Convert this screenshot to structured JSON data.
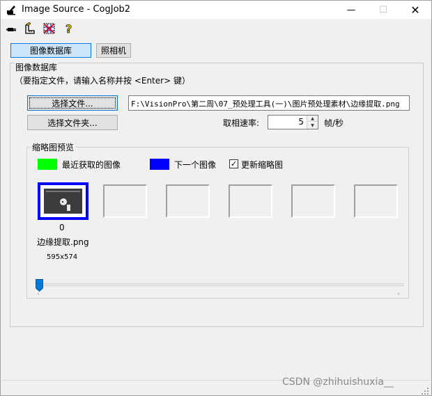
{
  "window": {
    "title": "Image Source - CogJob2",
    "controls": {
      "minimize": "—",
      "maximize": "☐",
      "close": "✕"
    }
  },
  "toolbar": {
    "icons": [
      "plug-icon",
      "ruler-icon",
      "grid-select-icon",
      "help-icon"
    ],
    "help_glyph": "?"
  },
  "tabs": [
    {
      "label": "图像数据库",
      "active": true
    },
    {
      "label": "照相机",
      "active": false
    }
  ],
  "panel": {
    "title": "图像数据库",
    "hint": "（要指定文件，请输入名称并按 <Enter> 键）",
    "select_file_label": "选择文件...",
    "select_folder_label": "选择文件夹...",
    "file_path": "F:\\VisionPro\\第二周\\07_预处理工具(一)\\图片预处理素材\\边缘提取.png",
    "rate_label": "取相速率:",
    "rate_value": "5",
    "rate_unit": "帧/秒"
  },
  "thumbnails": {
    "group_title": "缩略图预览",
    "legend_recent": "最近获取的图像",
    "legend_next": "下一个图像",
    "recent_color": "#00ff00",
    "next_color": "#0000ff",
    "refresh_label": "更新缩略图",
    "refresh_checked": "✓",
    "items": [
      {
        "index": "0",
        "name": "边缘提取.png",
        "size": "595x574"
      }
    ],
    "empty_slots": 5,
    "slider_position": 0
  },
  "watermark": "CSDN @zhihuishuxia__"
}
